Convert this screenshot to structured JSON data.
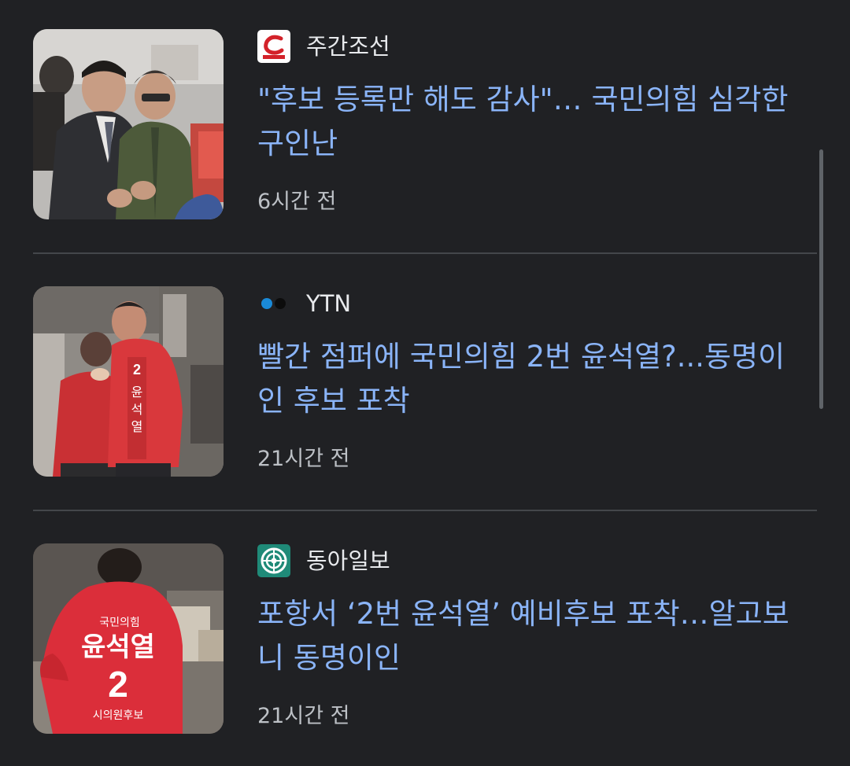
{
  "articles": [
    {
      "source": "주간조선",
      "source_logo": "jugan-chosun-logo",
      "headline": "\"후보 등록만 해도 감사\"… 국민의힘 심각한 구인난",
      "time": "6시간 전",
      "thumbnail": "photo-two-men-greeting"
    },
    {
      "source": "YTN",
      "source_logo": "ytn-logo",
      "headline": "빨간 점퍼에 국민의힘 2번 윤석열?...동명이인 후보 포착",
      "time": "21시간 전",
      "thumbnail": "photo-candidate-red-jacket",
      "thumbnail_text": "2 윤 석 열"
    },
    {
      "source": "동아일보",
      "source_logo": "donga-ilbo-logo",
      "headline": "포항서 ‘2번 윤석열’ 예비후보 포착…알고보니 동명이인",
      "time": "21시간 전",
      "thumbnail": "photo-candidate-back-jacket",
      "thumbnail_text": {
        "party": "국민의힘",
        "name": "윤석열",
        "number": "2",
        "role": "시의원후보"
      }
    }
  ],
  "colors": {
    "background": "#202124",
    "headline": "#8ab4f8",
    "source": "#e8eaed",
    "time": "#bdc1c6",
    "divider": "#44474b",
    "accent_red": "#d32f37"
  }
}
